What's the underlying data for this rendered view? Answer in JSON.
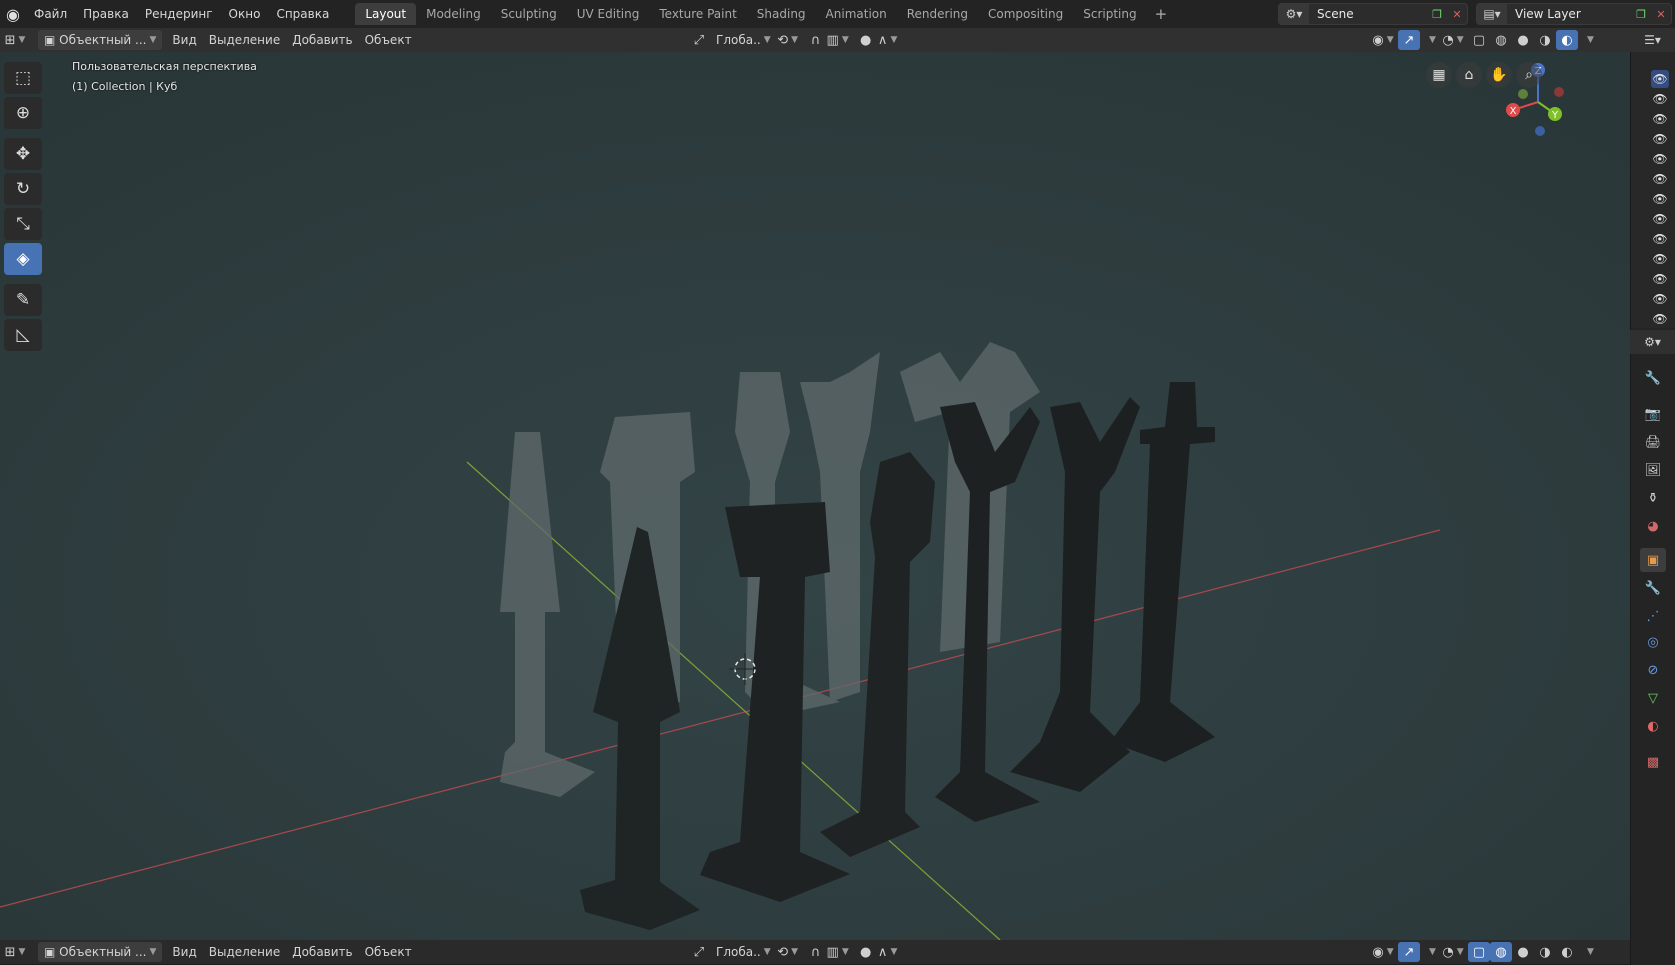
{
  "topbar": {
    "menus": [
      "Файл",
      "Правка",
      "Рендеринг",
      "Окно",
      "Справка"
    ],
    "workspaces": [
      "Layout",
      "Modeling",
      "Sculpting",
      "UV Editing",
      "Texture Paint",
      "Shading",
      "Animation",
      "Rendering",
      "Compositing",
      "Scripting"
    ],
    "active_workspace": "Layout",
    "add_tab": "+",
    "scene": "Scene",
    "view_layer": "View Layer"
  },
  "header": {
    "mode": "Объектный ...",
    "menus": [
      "Вид",
      "Выделение",
      "Добавить",
      "Объект"
    ],
    "orientation": "Глоба..",
    "accent": "#4772b3"
  },
  "viewport": {
    "view_name": "Пользовательская перспектива",
    "object_info": "(1) Collection | Куб",
    "background": "#2c3b3d",
    "gizmo_labels": {
      "x": "X",
      "y": "Y",
      "z": "Z"
    }
  },
  "toolbar_icons": [
    "select-box-icon",
    "cursor-icon",
    "move-icon",
    "rotate-icon",
    "scale-icon",
    "transform-icon",
    "annotate-icon",
    "measure-icon"
  ],
  "outliner": {
    "visible_rows": 13
  },
  "properties_tabs": [
    "tool",
    "render",
    "output",
    "view-layer",
    "scene",
    "world",
    "object",
    "modifiers",
    "particles",
    "physics",
    "constraints",
    "data",
    "material",
    "texture"
  ]
}
